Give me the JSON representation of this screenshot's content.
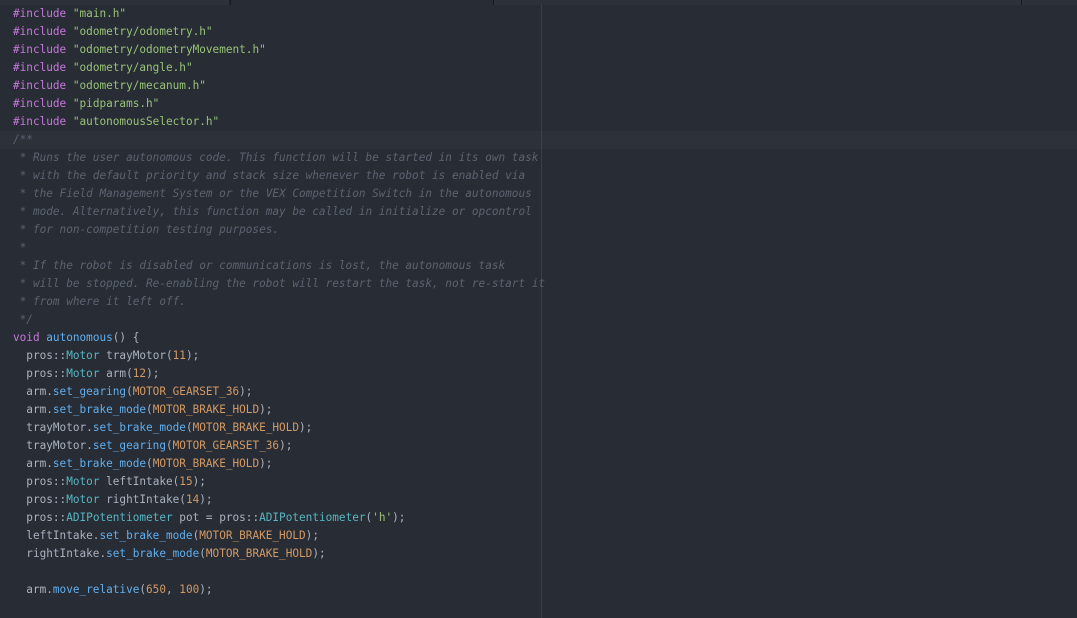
{
  "editor": {
    "lines": [
      [
        {
          "t": "#include",
          "c": "kw"
        },
        {
          "t": " ",
          "c": "plain"
        },
        {
          "t": "\"main.h\"",
          "c": "str"
        }
      ],
      [
        {
          "t": "#include",
          "c": "kw"
        },
        {
          "t": " ",
          "c": "plain"
        },
        {
          "t": "\"odometry/odometry.h\"",
          "c": "str"
        }
      ],
      [
        {
          "t": "#include",
          "c": "kw"
        },
        {
          "t": " ",
          "c": "plain"
        },
        {
          "t": "\"odometry/odometryMovement.h\"",
          "c": "str"
        }
      ],
      [
        {
          "t": "#include",
          "c": "kw"
        },
        {
          "t": " ",
          "c": "plain"
        },
        {
          "t": "\"odometry/angle.h\"",
          "c": "str"
        }
      ],
      [
        {
          "t": "#include",
          "c": "kw"
        },
        {
          "t": " ",
          "c": "plain"
        },
        {
          "t": "\"odometry/mecanum.h\"",
          "c": "str"
        }
      ],
      [
        {
          "t": "#include",
          "c": "kw"
        },
        {
          "t": " ",
          "c": "plain"
        },
        {
          "t": "\"pidparams.h\"",
          "c": "str"
        }
      ],
      [
        {
          "t": "#include",
          "c": "kw"
        },
        {
          "t": " ",
          "c": "plain"
        },
        {
          "t": "\"autonomousSelector.h\"",
          "c": "str"
        }
      ],
      [
        {
          "t": "/**",
          "c": "cmt"
        }
      ],
      [
        {
          "t": " * Runs the user autonomous code. This function will be started in its own task",
          "c": "cmt"
        }
      ],
      [
        {
          "t": " * with the default priority and stack size whenever the robot is enabled via",
          "c": "cmt"
        }
      ],
      [
        {
          "t": " * the Field Management System or the VEX Competition Switch in the autonomous",
          "c": "cmt"
        }
      ],
      [
        {
          "t": " * mode. Alternatively, this function may be called in initialize or opcontrol",
          "c": "cmt"
        }
      ],
      [
        {
          "t": " * for non-competition testing purposes.",
          "c": "cmt"
        }
      ],
      [
        {
          "t": " *",
          "c": "cmt"
        }
      ],
      [
        {
          "t": " * If the robot is disabled or communications is lost, the autonomous task",
          "c": "cmt"
        }
      ],
      [
        {
          "t": " * will be stopped. Re-enabling the robot will restart the task, not re-start it",
          "c": "cmt"
        }
      ],
      [
        {
          "t": " * from where it left off.",
          "c": "cmt"
        }
      ],
      [
        {
          "t": " */",
          "c": "cmt"
        }
      ],
      [
        {
          "t": "void",
          "c": "kw"
        },
        {
          "t": " ",
          "c": "plain"
        },
        {
          "t": "autonomous",
          "c": "fn"
        },
        {
          "t": "() {",
          "c": "plain"
        }
      ],
      [
        {
          "t": "  pros::",
          "c": "plain"
        },
        {
          "t": "Motor",
          "c": "cls"
        },
        {
          "t": " trayMotor(",
          "c": "plain"
        },
        {
          "t": "11",
          "c": "num"
        },
        {
          "t": ");",
          "c": "plain"
        }
      ],
      [
        {
          "t": "  pros::",
          "c": "plain"
        },
        {
          "t": "Motor",
          "c": "cls"
        },
        {
          "t": " arm(",
          "c": "plain"
        },
        {
          "t": "12",
          "c": "num"
        },
        {
          "t": ");",
          "c": "plain"
        }
      ],
      [
        {
          "t": "  arm.",
          "c": "plain"
        },
        {
          "t": "set_gearing",
          "c": "fn"
        },
        {
          "t": "(",
          "c": "plain"
        },
        {
          "t": "MOTOR_GEARSET_36",
          "c": "const"
        },
        {
          "t": ");",
          "c": "plain"
        }
      ],
      [
        {
          "t": "  arm.",
          "c": "plain"
        },
        {
          "t": "set_brake_mode",
          "c": "fn"
        },
        {
          "t": "(",
          "c": "plain"
        },
        {
          "t": "MOTOR_BRAKE_HOLD",
          "c": "const"
        },
        {
          "t": ");",
          "c": "plain"
        }
      ],
      [
        {
          "t": "  trayMotor.",
          "c": "plain"
        },
        {
          "t": "set_brake_mode",
          "c": "fn"
        },
        {
          "t": "(",
          "c": "plain"
        },
        {
          "t": "MOTOR_BRAKE_HOLD",
          "c": "const"
        },
        {
          "t": ");",
          "c": "plain"
        }
      ],
      [
        {
          "t": "  trayMotor.",
          "c": "plain"
        },
        {
          "t": "set_gearing",
          "c": "fn"
        },
        {
          "t": "(",
          "c": "plain"
        },
        {
          "t": "MOTOR_GEARSET_36",
          "c": "const"
        },
        {
          "t": ");",
          "c": "plain"
        }
      ],
      [
        {
          "t": "  arm.",
          "c": "plain"
        },
        {
          "t": "set_brake_mode",
          "c": "fn"
        },
        {
          "t": "(",
          "c": "plain"
        },
        {
          "t": "MOTOR_BRAKE_HOLD",
          "c": "const"
        },
        {
          "t": ");",
          "c": "plain"
        }
      ],
      [
        {
          "t": "  pros::",
          "c": "plain"
        },
        {
          "t": "Motor",
          "c": "cls"
        },
        {
          "t": " leftIntake(",
          "c": "plain"
        },
        {
          "t": "15",
          "c": "num"
        },
        {
          "t": ");",
          "c": "plain"
        }
      ],
      [
        {
          "t": "  pros::",
          "c": "plain"
        },
        {
          "t": "Motor",
          "c": "cls"
        },
        {
          "t": " rightIntake(",
          "c": "plain"
        },
        {
          "t": "14",
          "c": "num"
        },
        {
          "t": ");",
          "c": "plain"
        }
      ],
      [
        {
          "t": "  pros::",
          "c": "plain"
        },
        {
          "t": "ADIPotentiometer",
          "c": "cls"
        },
        {
          "t": " pot = pros::",
          "c": "plain"
        },
        {
          "t": "ADIPotentiometer",
          "c": "cls"
        },
        {
          "t": "(",
          "c": "plain"
        },
        {
          "t": "'h'",
          "c": "str"
        },
        {
          "t": ");",
          "c": "plain"
        }
      ],
      [
        {
          "t": "  leftIntake.",
          "c": "plain"
        },
        {
          "t": "set_brake_mode",
          "c": "fn"
        },
        {
          "t": "(",
          "c": "plain"
        },
        {
          "t": "MOTOR_BRAKE_HOLD",
          "c": "const"
        },
        {
          "t": ");",
          "c": "plain"
        }
      ],
      [
        {
          "t": "  rightIntake.",
          "c": "plain"
        },
        {
          "t": "set_brake_mode",
          "c": "fn"
        },
        {
          "t": "(",
          "c": "plain"
        },
        {
          "t": "MOTOR_BRAKE_HOLD",
          "c": "const"
        },
        {
          "t": ");",
          "c": "plain"
        }
      ],
      [
        {
          "t": "",
          "c": "plain"
        }
      ],
      [
        {
          "t": "  arm.",
          "c": "plain"
        },
        {
          "t": "move_relative",
          "c": "fn"
        },
        {
          "t": "(",
          "c": "plain"
        },
        {
          "t": "650",
          "c": "num"
        },
        {
          "t": ", ",
          "c": "plain"
        },
        {
          "t": "100",
          "c": "num"
        },
        {
          "t": ");",
          "c": "plain"
        }
      ]
    ]
  },
  "colors": {
    "background": "#282c34",
    "keyword": "#c678dd",
    "string": "#98c379",
    "comment": "#5c6370",
    "function": "#61afef",
    "class": "#56b6c2",
    "number": "#d19a66",
    "text": "#abb2bf"
  }
}
